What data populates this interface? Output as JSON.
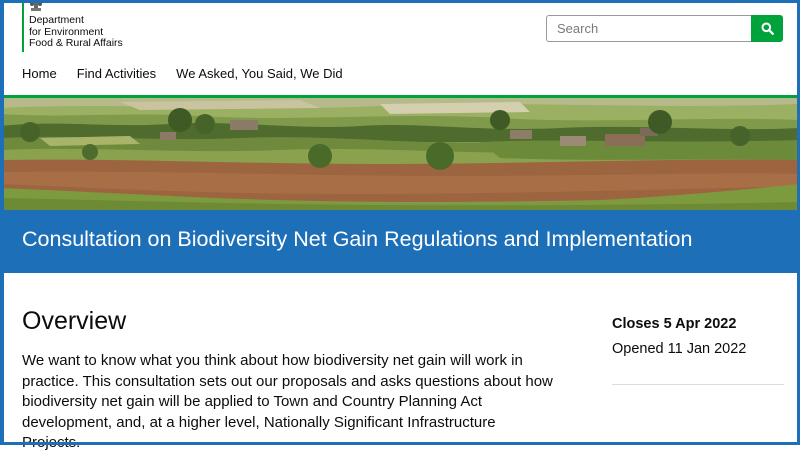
{
  "header": {
    "logo_lines": [
      "Department",
      "for Environment",
      "Food & Rural Affairs"
    ],
    "search_placeholder": "Search"
  },
  "nav": {
    "items": [
      "Home",
      "Find Activities",
      "We Asked, You Said, We Did"
    ]
  },
  "banner": {
    "title": "Consultation on Biodiversity Net Gain Regulations and Implementation"
  },
  "main": {
    "heading": "Overview",
    "body": "We want to know what you think about how biodiversity net gain will work in practice. This consultation sets out our proposals and asks questions about how biodiversity net gain will be applied to Town and Country Planning Act development, and, at a higher level, Nationally Significant Infrastructure Projects."
  },
  "sidebar": {
    "closes": "Closes 5 Apr 2022",
    "opened": "Opened 11 Jan 2022"
  },
  "colors": {
    "brand_green": "#00a33b",
    "banner_blue": "#1d70b8"
  }
}
